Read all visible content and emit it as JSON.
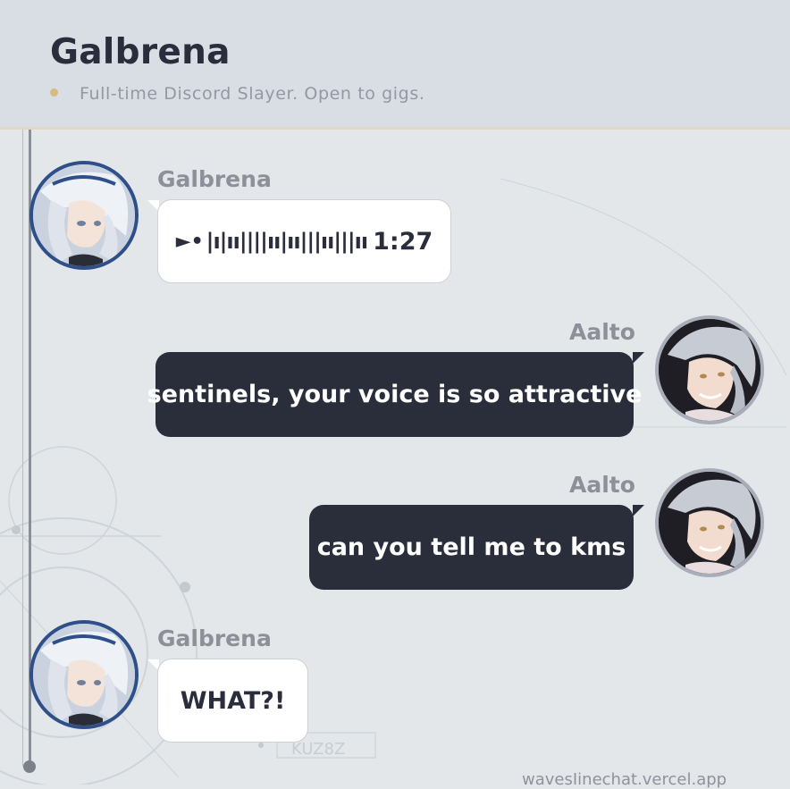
{
  "header": {
    "title": "Galbrena",
    "status": "Full-time Discord Slayer. Open to gigs."
  },
  "messages": [
    {
      "sender": "Galbrena",
      "side": "left",
      "type": "voice",
      "play_icon": "►•",
      "waveform": "|ı|ıı||||ıı|ıı|||ıı|||ıı",
      "duration": "1:27"
    },
    {
      "sender": "Aalto",
      "side": "right",
      "type": "text",
      "text": "sentinels, your voice is so attractive"
    },
    {
      "sender": "Aalto",
      "side": "right",
      "type": "text",
      "text": "can you tell me to kms"
    },
    {
      "sender": "Galbrena",
      "side": "left",
      "type": "text",
      "text": "WHAT?!"
    }
  ],
  "background_label": "KUZ8Z",
  "footer": {
    "watermark": "wavesIinechat.vercel.app"
  },
  "colors": {
    "header_bg": "#d9dde4",
    "accent_gold": "#d6bb7a",
    "outgoing_bubble": "#2a2e3b",
    "incoming_bubble": "#ffffff",
    "galbrena_avatar_ring": "#2e4f87",
    "aalto_avatar_ring": "#a9adb9"
  }
}
